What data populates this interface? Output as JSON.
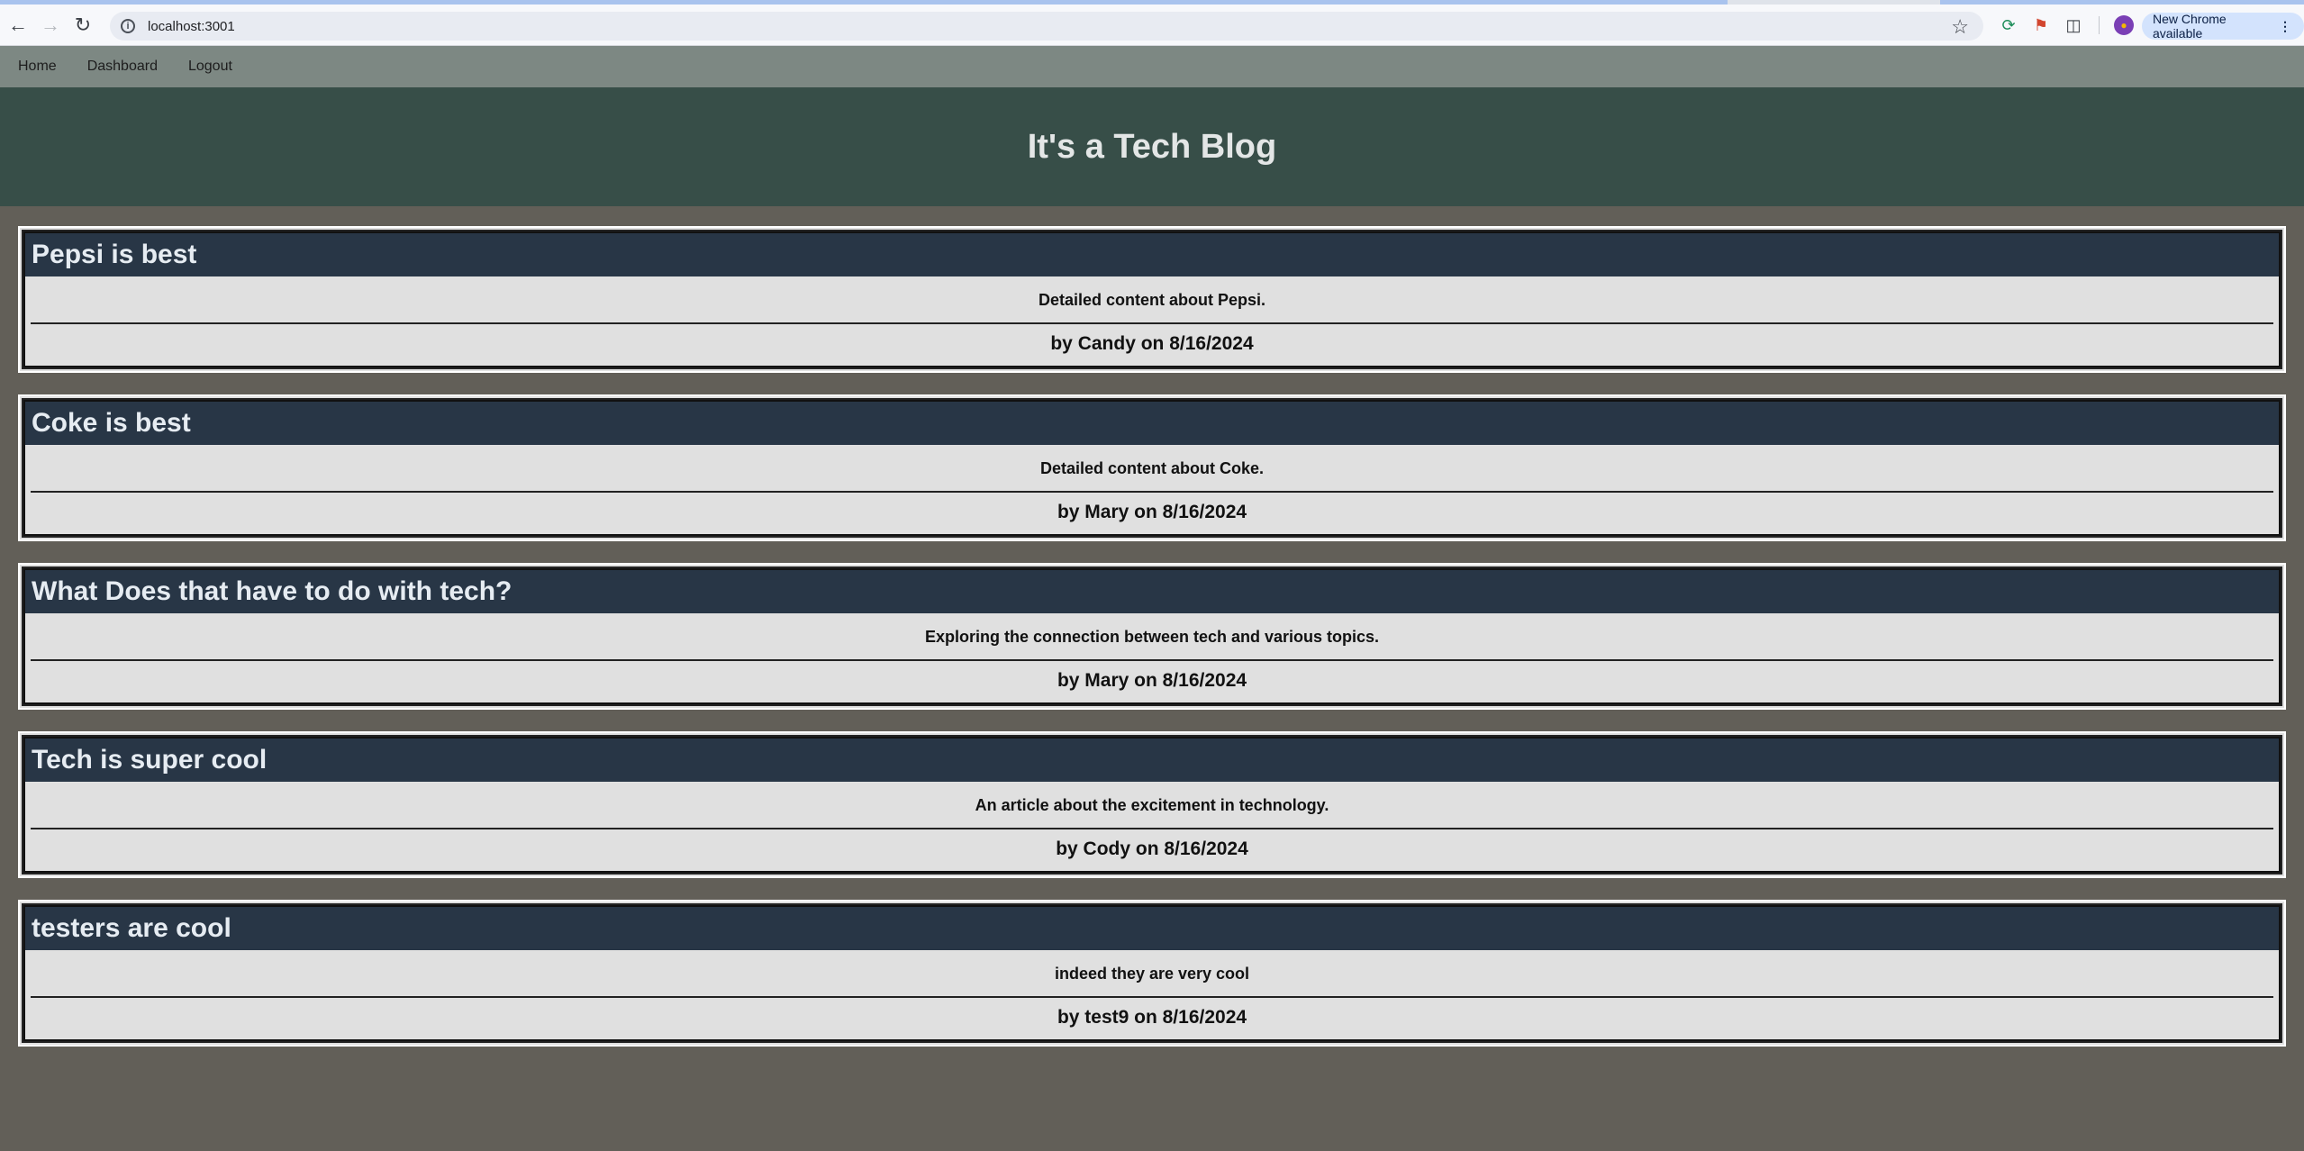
{
  "browser": {
    "url": "localhost:3001",
    "update_label": "New Chrome available"
  },
  "nav": {
    "home": "Home",
    "dashboard": "Dashboard",
    "logout": "Logout"
  },
  "header": {
    "title": "It's a Tech Blog"
  },
  "posts": [
    {
      "title": "Pepsi is best",
      "content": "Detailed content about Pepsi.",
      "meta": "by Candy on 8/16/2024"
    },
    {
      "title": "Coke is best",
      "content": "Detailed content about Coke.",
      "meta": "by Mary on 8/16/2024"
    },
    {
      "title": "What Does that have to do with tech?",
      "content": "Exploring the connection between tech and various topics.",
      "meta": "by Mary on 8/16/2024"
    },
    {
      "title": "Tech is super cool",
      "content": "An article about the excitement in technology.",
      "meta": "by Cody on 8/16/2024"
    },
    {
      "title": "testers are cool",
      "content": "indeed they are very cool",
      "meta": "by test9 on 8/16/2024"
    }
  ]
}
